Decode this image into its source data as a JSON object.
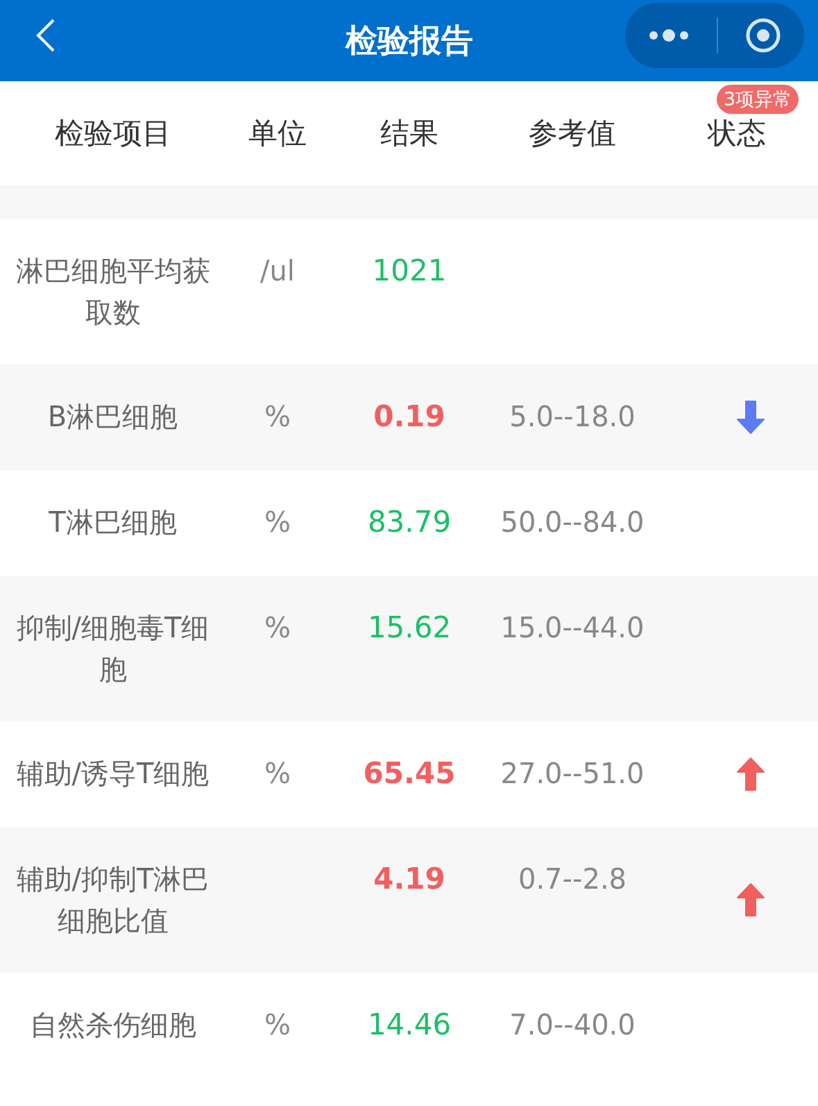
{
  "nav": {
    "title": "检验报告"
  },
  "columns": [
    "检验项目",
    "单位",
    "结果",
    "参考值",
    "状态"
  ],
  "abnormal_badge": "3项异常",
  "rows": [
    {
      "name": "淋巴细胞平均获取数",
      "unit": "/ul",
      "result": "1021",
      "reference": "",
      "kind": "normal"
    },
    {
      "name": "B淋巴细胞",
      "unit": "%",
      "result": "0.19",
      "reference": "5.0--18.0",
      "kind": "low"
    },
    {
      "name": "T淋巴细胞",
      "unit": "%",
      "result": "83.79",
      "reference": "50.0--84.0",
      "kind": "normal"
    },
    {
      "name": "抑制/细胞毒T细胞",
      "unit": "%",
      "result": "15.62",
      "reference": "15.0--44.0",
      "kind": "normal"
    },
    {
      "name": "辅助/诱导T细胞",
      "unit": "%",
      "result": "65.45",
      "reference": "27.0--51.0",
      "kind": "high"
    },
    {
      "name": "辅助/抑制T淋巴细胞比值",
      "unit": "",
      "result": "4.19",
      "reference": "0.7--2.8",
      "kind": "high"
    },
    {
      "name": "自然杀伤细胞",
      "unit": "%",
      "result": "14.46",
      "reference": "7.0--40.0",
      "kind": "normal"
    }
  ]
}
